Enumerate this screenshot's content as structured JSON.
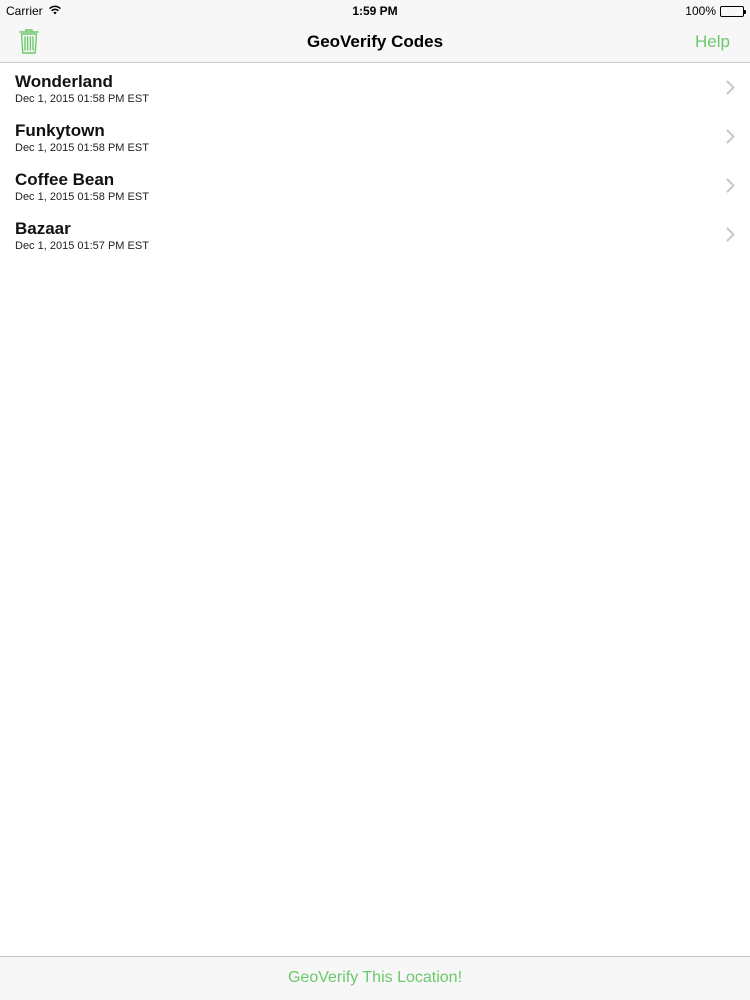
{
  "status_bar": {
    "carrier": "Carrier",
    "time": "1:59 PM",
    "battery": "100%",
    "battery_level": 1.0,
    "icons": [
      "wifi-icon",
      "battery-icon"
    ]
  },
  "nav": {
    "title": "GeoVerify Codes",
    "help_label": "Help",
    "left_icon": "trash-icon",
    "accent_color": "#6cc96a"
  },
  "codes": [
    {
      "name": "Wonderland",
      "date": "Dec 1, 2015 01:58 PM EST"
    },
    {
      "name": "Funkytown",
      "date": "Dec 1, 2015 01:58 PM EST"
    },
    {
      "name": "Coffee Bean",
      "date": "Dec 1, 2015 01:58 PM EST"
    },
    {
      "name": "Bazaar",
      "date": "Dec 1, 2015 01:57 PM EST"
    }
  ],
  "toolbar": {
    "action_label": "GeoVerify This Location!"
  }
}
